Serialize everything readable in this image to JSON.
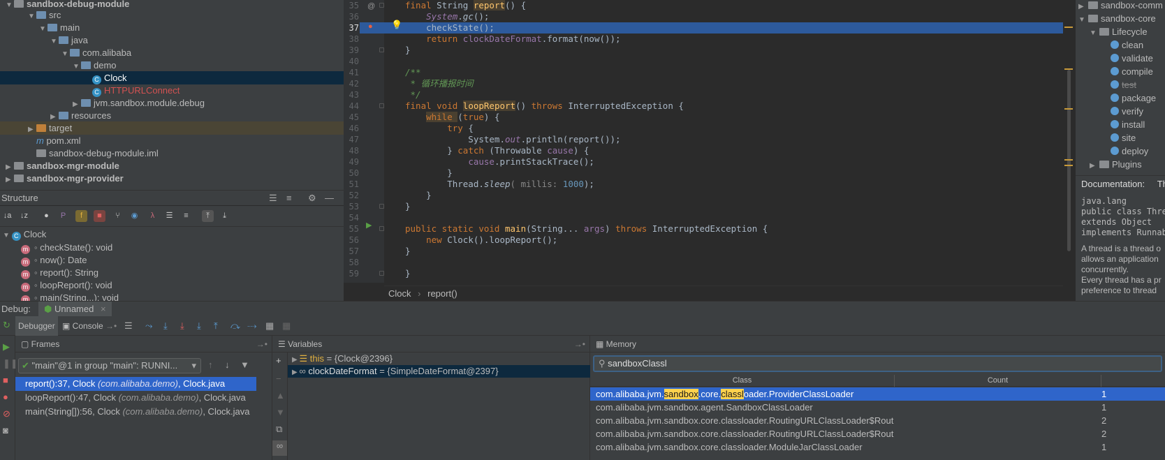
{
  "project_tree": [
    {
      "label": "sandbox-debug-module",
      "kind": "module",
      "state": "open"
    },
    {
      "label": "src",
      "kind": "folder",
      "state": "open"
    },
    {
      "label": "main",
      "kind": "folder",
      "state": "open"
    },
    {
      "label": "java",
      "kind": "folder-blue",
      "state": "open"
    },
    {
      "label": "com.alibaba",
      "kind": "package",
      "state": "open"
    },
    {
      "label": "demo",
      "kind": "package",
      "state": "open"
    },
    {
      "label": "Clock",
      "kind": "class",
      "state": "leaf",
      "selected": true
    },
    {
      "label": "HTTPURLConnect",
      "kind": "class-error",
      "state": "leaf"
    },
    {
      "label": "jvm.sandbox.module.debug",
      "kind": "package",
      "state": "closed"
    },
    {
      "label": "resources",
      "kind": "folder",
      "state": "closed"
    },
    {
      "label": "target",
      "kind": "folder-orange",
      "state": "closed"
    },
    {
      "label": "pom.xml",
      "kind": "maven",
      "state": "leaf"
    },
    {
      "label": "sandbox-debug-module.iml",
      "kind": "file",
      "state": "leaf"
    },
    {
      "label": "sandbox-mgr-module",
      "kind": "module",
      "state": "closed"
    },
    {
      "label": "sandbox-mgr-provider",
      "kind": "module",
      "state": "closed"
    }
  ],
  "structure": {
    "title": "Structure",
    "root": "Clock",
    "items": [
      "checkState(): void",
      "now(): Date",
      "report(): String",
      "loopReport(): void",
      "main(String...): void"
    ]
  },
  "editor": {
    "lines": [
      {
        "n": "35",
        "html": [
          [
            "kw",
            "final "
          ],
          [
            "ty",
            "String "
          ],
          [
            "fn",
            "report"
          ],
          [
            "ty",
            "() {"
          ]
        ]
      },
      {
        "n": "36",
        "html": [
          [
            "ty",
            "    "
          ],
          [
            "stat",
            "System"
          ],
          [
            "ty",
            "."
          ],
          [
            "it",
            "gc"
          ],
          [
            "ty",
            "();"
          ]
        ]
      },
      {
        "n": "37",
        "html": [
          [
            "ty",
            "    checkState();"
          ]
        ]
      },
      {
        "n": "38",
        "html": [
          [
            "ty",
            "    "
          ],
          [
            "kw",
            "return "
          ],
          [
            "fld",
            "clockDateFormat"
          ],
          [
            "ty",
            ".format(now());"
          ]
        ]
      },
      {
        "n": "39",
        "html": [
          [
            "ty",
            "}"
          ]
        ]
      },
      {
        "n": "40",
        "html": [
          [
            "ty",
            ""
          ]
        ]
      },
      {
        "n": "41",
        "html": [
          [
            "cm",
            "/**"
          ]
        ]
      },
      {
        "n": "42",
        "html": [
          [
            "cm",
            " * 循环播报时间"
          ]
        ]
      },
      {
        "n": "43",
        "html": [
          [
            "cm",
            " */"
          ]
        ]
      },
      {
        "n": "44",
        "html": [
          [
            "kw",
            "final void "
          ],
          [
            "fn",
            "loopReport"
          ],
          [
            "ty",
            "() "
          ],
          [
            "kw",
            "throws "
          ],
          [
            "ty",
            "InterruptedException {"
          ]
        ]
      },
      {
        "n": "45",
        "html": [
          [
            "ty",
            "    "
          ],
          [
            "kw",
            "while "
          ],
          [
            "ty",
            "("
          ],
          [
            "kw",
            "true"
          ],
          [
            "ty",
            ") {"
          ]
        ]
      },
      {
        "n": "46",
        "html": [
          [
            "ty",
            "        "
          ],
          [
            "kw",
            "try "
          ],
          [
            "ty",
            "{"
          ]
        ]
      },
      {
        "n": "47",
        "html": [
          [
            "ty",
            "            System."
          ],
          [
            "stat",
            "out"
          ],
          [
            "ty",
            ".println(report());"
          ]
        ]
      },
      {
        "n": "48",
        "html": [
          [
            "ty",
            "        } "
          ],
          [
            "kw",
            "catch "
          ],
          [
            "ty",
            "(Throwable "
          ],
          [
            "fld",
            "cause"
          ],
          [
            "ty",
            ") {"
          ]
        ]
      },
      {
        "n": "49",
        "html": [
          [
            "ty",
            "            "
          ],
          [
            "fld",
            "cause"
          ],
          [
            "ty",
            ".printStackTrace();"
          ]
        ]
      },
      {
        "n": "50",
        "html": [
          [
            "ty",
            "        }"
          ]
        ]
      },
      {
        "n": "51",
        "html": [
          [
            "ty",
            "        Thread."
          ],
          [
            "it",
            "sleep"
          ],
          [
            "ty",
            "( millis: "
          ],
          [
            "num",
            "1000"
          ],
          [
            "ty",
            ");"
          ]
        ]
      },
      {
        "n": "52",
        "html": [
          [
            "ty",
            "    }"
          ]
        ]
      },
      {
        "n": "53",
        "html": [
          [
            "ty",
            "}"
          ]
        ]
      },
      {
        "n": "54",
        "html": [
          [
            "ty",
            ""
          ]
        ]
      },
      {
        "n": "55",
        "html": [
          [
            "kw",
            "public static void "
          ],
          [
            "fn",
            "main"
          ],
          [
            "ty",
            "(String... "
          ],
          [
            "fld",
            "args"
          ],
          [
            "ty",
            ") "
          ],
          [
            "kw",
            "throws "
          ],
          [
            "ty",
            "InterruptedException {"
          ]
        ]
      },
      {
        "n": "56",
        "html": [
          [
            "ty",
            "    "
          ],
          [
            "kw",
            "new "
          ],
          [
            "ty",
            "Clock().loopReport();"
          ]
        ]
      },
      {
        "n": "57",
        "html": [
          [
            "ty",
            "}"
          ]
        ]
      },
      {
        "n": "58",
        "html": [
          [
            "ty",
            ""
          ]
        ]
      },
      {
        "n": "59",
        "html": [
          [
            "ty",
            "}"
          ]
        ]
      }
    ],
    "breadcrumb": [
      "Clock",
      "report()"
    ]
  },
  "maven": {
    "items": [
      "sandbox-comm",
      "sandbox-core",
      "Lifecycle",
      "clean",
      "validate",
      "compile",
      "test",
      "package",
      "verify",
      "install",
      "site",
      "deploy",
      "Plugins"
    ]
  },
  "documentation": {
    "tab": "Documentation:",
    "tab2": "Th",
    "lines": [
      "java.lang",
      "public class Thre",
      "extends Object",
      "implements Runnab",
      "",
      "A thread is a thread o",
      "allows an application",
      "concurrently.",
      "Every thread has a pr",
      "preference to thread"
    ]
  },
  "debug": {
    "label": "Debug:",
    "session": "Unnamed",
    "tabs": {
      "debugger": "Debugger",
      "console": "Console"
    },
    "frames_title": "Frames",
    "thread": "\"main\"@1 in group \"main\": RUNNI...",
    "frames": [
      {
        "method": "report():37, Clock ",
        "pkg": "(com.alibaba.demo)",
        "file": ", Clock.java",
        "selected": true
      },
      {
        "method": "loopReport():47, Clock ",
        "pkg": "(com.alibaba.demo)",
        "file": ", Clock.java",
        "selected": false
      },
      {
        "method": "main(String[]):56, Clock ",
        "pkg": "(com.alibaba.demo)",
        "file": ", Clock.java",
        "selected": false
      }
    ],
    "variables_title": "Variables",
    "variables": [
      {
        "name": "this",
        "value": "= {Clock@2396}"
      },
      {
        "name": "clockDateFormat",
        "value": "= {SimpleDateFormat@2397}"
      }
    ],
    "memory_title": "Memory",
    "memory_search": "sandboxClassl",
    "memory_cols": {
      "class": "Class",
      "count": "Count"
    },
    "memory_rows": [
      {
        "cls": "com.alibaba.jvm.sandbox.core.classloader.ProviderClassLoader",
        "count": "1",
        "selected": true
      },
      {
        "cls": "com.alibaba.jvm.sandbox.agent.SandboxClassLoader",
        "count": "1",
        "selected": false
      },
      {
        "cls": "com.alibaba.jvm.sandbox.core.classloader.RoutingURLClassLoader$Rout",
        "count": "2",
        "selected": false
      },
      {
        "cls": "com.alibaba.jvm.sandbox.core.classloader.RoutingURLClassLoader$Rout",
        "count": "2",
        "selected": false
      },
      {
        "cls": "com.alibaba.jvm.sandbox.core.classloader.ModuleJarClassLoader",
        "count": "1",
        "selected": false
      }
    ]
  }
}
